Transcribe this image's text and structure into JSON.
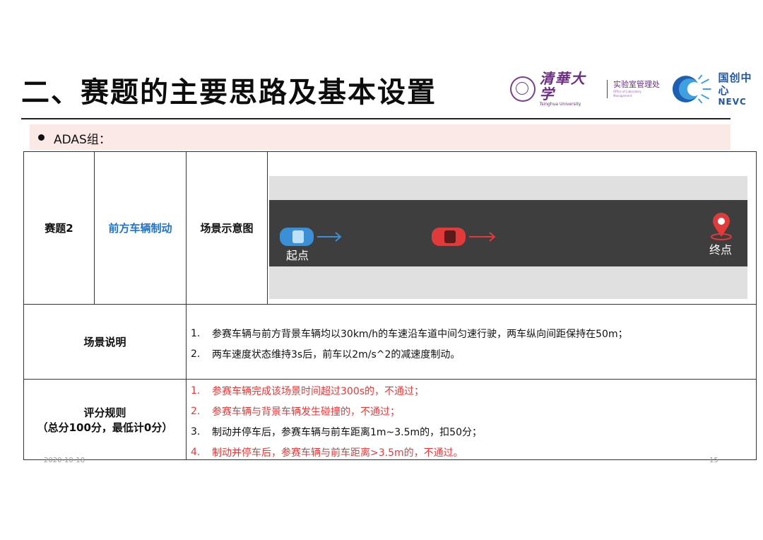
{
  "header": {
    "title": "二、赛题的主要思路及基本设置",
    "logo_thu_cn": "清華大学",
    "logo_thu_en": "Tsinghua University",
    "logo_lab_cn": "实验室管理处",
    "logo_lab_en": "Office of Laboratory Management",
    "logo_nevc_cn": "国创中心",
    "logo_nevc_en": "NEVC"
  },
  "bullet": {
    "text": "ADAS组："
  },
  "table": {
    "task_id": "赛题2",
    "task_name": "前方车辆制动",
    "diagram_label": "场景示意图",
    "scene": {
      "start_label": "起点",
      "end_label": "终点",
      "ego_color": "#3a8fd6",
      "lead_color": "#e03a3a"
    },
    "desc_label": "场景说明",
    "desc_items": [
      {
        "num": "1.",
        "text": "参赛车辆与前方背景车辆均以30km/h的车速沿车道中间匀速行驶，两车纵向间距保持在50m；"
      },
      {
        "num": "2.",
        "text": "两车速度状态维持3s后，前车以2m/s^2的减速度制动。"
      }
    ],
    "rules_label": "评分规则",
    "rules_sublabel": "（总分100分，最低计0分）",
    "rule_items": [
      {
        "num": "1.",
        "text": "参赛车辆完成该场景时间超过300s的，不通过；",
        "color": "#e23a3a"
      },
      {
        "num": "2.",
        "text": "参赛车辆与背景车辆发生碰撞的，不通过；",
        "color": "#e23a3a"
      },
      {
        "num": "3.",
        "text": "制动并停车后，参赛车辆与前车距离1m~3.5m的，扣50分；",
        "color": "#111111"
      },
      {
        "num": "4.",
        "text": "制动并停车后，参赛车辆与前车距离>3.5m的，不通过。",
        "color": "#e23a3a"
      }
    ]
  },
  "footer": {
    "date": "2020-10-18",
    "page": "15"
  }
}
